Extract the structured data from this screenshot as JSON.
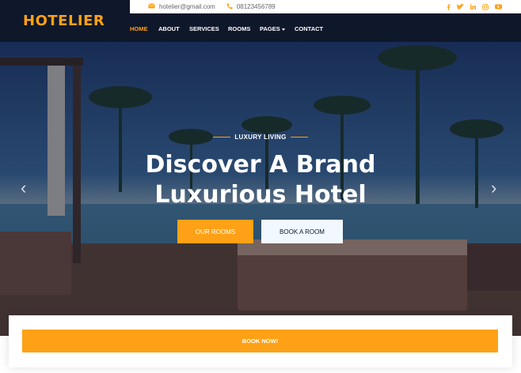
{
  "brand": {
    "name": "HOTELIER"
  },
  "topbar": {
    "email": "hotelier@gmail.com",
    "phone": "08123456789",
    "social": [
      "facebook",
      "twitter",
      "linkedin",
      "instagram",
      "youtube"
    ]
  },
  "nav": {
    "items": [
      {
        "label": "HOME",
        "active": true
      },
      {
        "label": "ABOUT",
        "active": false
      },
      {
        "label": "SERVICES",
        "active": false
      },
      {
        "label": "ROOMS",
        "active": false
      },
      {
        "label": "PAGES",
        "active": false,
        "dropdown": true
      },
      {
        "label": "CONTACT",
        "active": false
      }
    ]
  },
  "hero": {
    "eyebrow": "LUXURY LIVING",
    "title_line1": "Discover A Brand",
    "title_line2": "Luxurious Hotel",
    "btn_primary": "OUR ROOMS",
    "btn_secondary": "BOOK A ROOM",
    "prev": "‹",
    "next": "›"
  },
  "booking": {
    "label": "BOOK NOW!"
  },
  "colors": {
    "primary": "#FEA116",
    "dark": "#0F172B",
    "light": "#F1F8FF"
  }
}
